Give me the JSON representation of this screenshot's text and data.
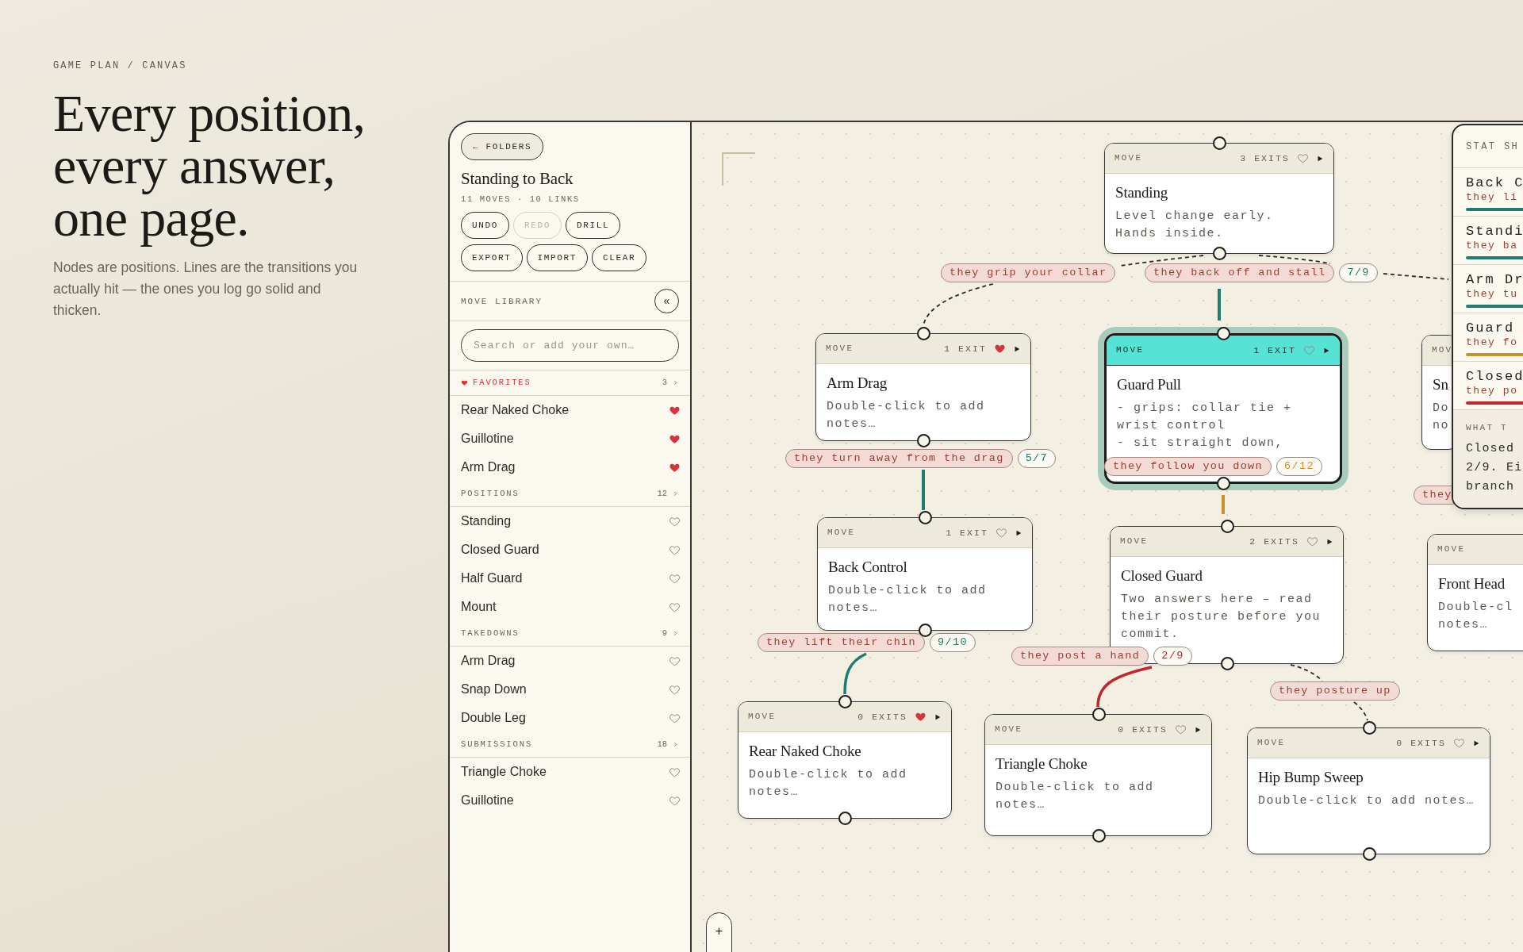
{
  "hero": {
    "breadcrumb": "GAME PLAN / CANVAS",
    "headline": [
      "Every position,",
      "every answer,",
      "one page."
    ],
    "description": "Nodes are positions. Lines are the transitions you actually hit — the ones you log go solid and thicken."
  },
  "sidebar": {
    "back_button": "← FOLDERS",
    "title": "Standing to Back",
    "meta": "11 MOVES · 10 LINKS",
    "actions": [
      {
        "label": "UNDO",
        "disabled": false
      },
      {
        "label": "REDO",
        "disabled": true
      },
      {
        "label": "DRILL",
        "disabled": false
      },
      {
        "label": "EXPORT",
        "disabled": false
      },
      {
        "label": "IMPORT",
        "disabled": false
      },
      {
        "label": "CLEAR",
        "disabled": false
      }
    ],
    "library_label": "MOVE LIBRARY",
    "collapse_button": "«",
    "search": {
      "placeholder": "Search or add your own…"
    },
    "sections": [
      {
        "kind": "favorites",
        "label": "FAVORITES",
        "count": "3",
        "items": [
          {
            "label": "Rear Naked Choke",
            "favorite": true
          },
          {
            "label": "Guillotine",
            "favorite": true
          },
          {
            "label": "Arm Drag",
            "favorite": true
          }
        ]
      },
      {
        "kind": "category",
        "label": "POSITIONS",
        "count": "12",
        "items": [
          {
            "label": "Standing",
            "favorite": false
          },
          {
            "label": "Closed Guard",
            "favorite": false
          },
          {
            "label": "Half Guard",
            "favorite": false
          },
          {
            "label": "Mount",
            "favorite": false
          }
        ]
      },
      {
        "kind": "category",
        "label": "TAKEDOWNS",
        "count": "9",
        "items": [
          {
            "label": "Arm Drag",
            "favorite": false
          },
          {
            "label": "Snap Down",
            "favorite": false
          },
          {
            "label": "Double Leg",
            "favorite": false
          }
        ]
      },
      {
        "kind": "category",
        "label": "SUBMISSIONS",
        "count": "18",
        "items": [
          {
            "label": "Triangle Choke",
            "favorite": false
          },
          {
            "label": "Guillotine",
            "favorite": false
          }
        ]
      }
    ]
  },
  "canvas": {
    "nodes": [
      {
        "kind": "full",
        "tag": "MOVE",
        "exits": "3 EXITS",
        "favorite": false,
        "selected": false,
        "title": "Standing",
        "notes": "Level change early.\nHands inside."
      },
      {
        "kind": "full",
        "tag": "MOVE",
        "exits": "1 EXIT",
        "favorite": true,
        "selected": false,
        "title": "Arm Drag",
        "notes": "Double-click to add notes…"
      },
      {
        "kind": "full",
        "tag": "MOVE",
        "exits": "1 EXIT",
        "favorite": false,
        "selected": true,
        "title": "Guard Pull",
        "notes": "- grips: collar tie + wrist control\n- sit straight down,"
      },
      {
        "kind": "cut",
        "tag": "MOV",
        "title": "Sn",
        "notes": "Do\nno"
      },
      {
        "kind": "full",
        "tag": "MOVE",
        "exits": "1 EXIT",
        "favorite": false,
        "selected": false,
        "title": "Back Control",
        "notes": "Double-click to add notes…"
      },
      {
        "kind": "full",
        "tag": "MOVE",
        "exits": "2 EXITS",
        "favorite": false,
        "selected": false,
        "title": "Closed Guard",
        "notes": "Two answers here – read their posture before you commit."
      },
      {
        "kind": "cut",
        "tag": "MOVE",
        "title": "Front Head",
        "notes": "Double-cl\nnotes…"
      },
      {
        "kind": "full",
        "tag": "MOVE",
        "exits": "0 EXITS",
        "favorite": true,
        "selected": false,
        "title": "Rear Naked Choke",
        "notes": "Double-click to add notes…"
      },
      {
        "kind": "full",
        "tag": "MOVE",
        "exits": "0 EXITS",
        "favorite": false,
        "selected": false,
        "title": "Triangle Choke",
        "notes": "Double-click to add notes…"
      },
      {
        "kind": "full",
        "tag": "MOVE",
        "exits": "0 EXITS",
        "favorite": false,
        "selected": false,
        "title": "Hip Bump Sweep",
        "notes": "Double-click to add notes…"
      }
    ],
    "transitions": [
      {
        "label": "they grip your collar",
        "logged": false
      },
      {
        "label": "they back off and stall",
        "count": "7/9",
        "color": "#1f7d6e",
        "logged": true
      },
      {
        "label": "they",
        "logged": false
      },
      {
        "label": "they turn away from the drag",
        "count": "5/7",
        "color": "#1f7d6e",
        "logged": true
      },
      {
        "label": "they follow you down",
        "count": "6/12",
        "color": "#c8922a",
        "logged": true
      },
      {
        "label": "they lift their chin",
        "count": "9/10",
        "color": "#1f7d6e",
        "logged": true
      },
      {
        "label": "they post a hand",
        "count": "2/9",
        "color": "#c0282d",
        "logged": true
      },
      {
        "label": "they posture up",
        "logged": false
      }
    ],
    "zoom_controls": [
      "+"
    ]
  },
  "stat_sheet": {
    "title": "STAT SH",
    "rows": [
      {
        "title": "Back C",
        "subtitle": "they li",
        "color": "#1f7d6e"
      },
      {
        "title": "Standi",
        "subtitle": "they ba",
        "color": "#1f7d6e"
      },
      {
        "title": "Arm Dr",
        "subtitle": "they tu",
        "color": "#1f7d6e"
      },
      {
        "title": "Guard",
        "subtitle": "they fo",
        "color": "#c8922a"
      },
      {
        "title": "Closed",
        "subtitle": "they po",
        "color": "#c0282d"
      }
    ],
    "advice": {
      "label": "WHAT T",
      "text": "Closed\n2/9. Ei\nbranch"
    }
  }
}
